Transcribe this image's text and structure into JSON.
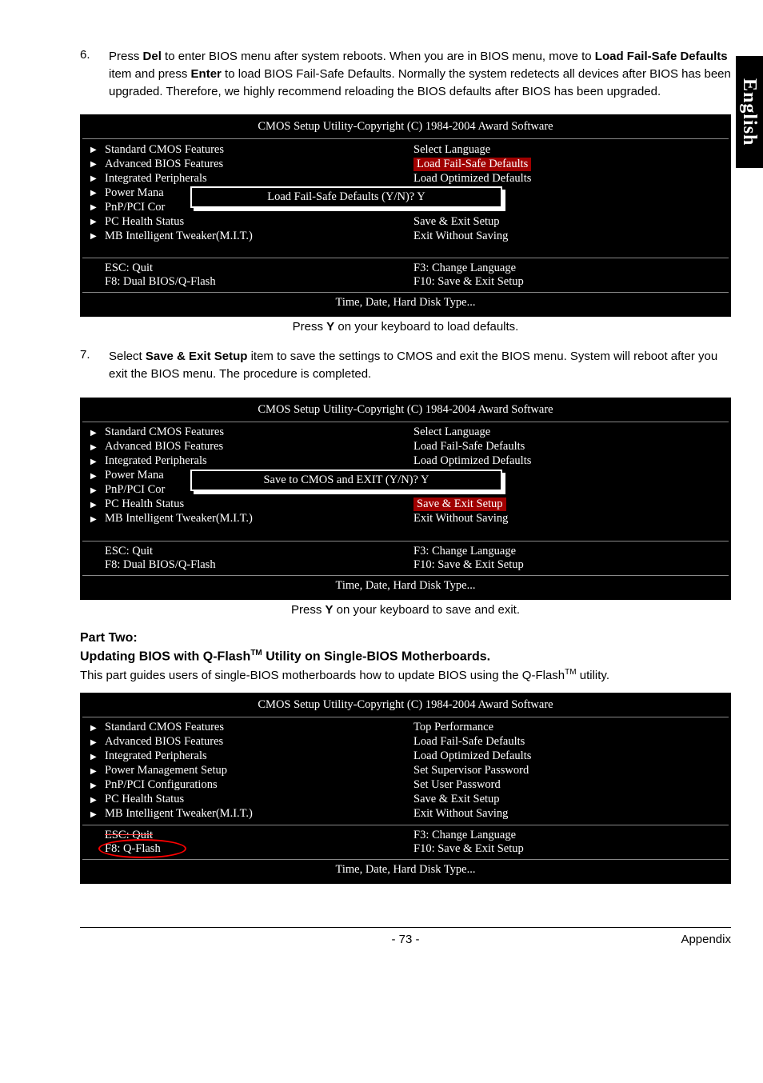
{
  "side_tab": "English",
  "step6": {
    "num": "6.",
    "text_a": "Press ",
    "key1": "Del",
    "text_b": " to enter BIOS menu after system reboots. When you are in BIOS menu, move to ",
    "bold2": "Load Fail-Safe Defaults",
    "text_c": " item and press ",
    "key2": "Enter",
    "text_d": " to load BIOS Fail-Safe Defaults. Normally the system redetects all devices after BIOS has been upgraded. Therefore, we highly recommend reloading the BIOS defaults after BIOS has been upgraded."
  },
  "bios1": {
    "title": "CMOS Setup Utility-Copyright (C) 1984-2004 Award Software",
    "left": [
      "Standard CMOS Features",
      "Advanced BIOS Features",
      "Integrated Peripherals",
      "Power Mana",
      "PnP/PCI Cor",
      "PC Health Status",
      "MB Intelligent Tweaker(M.I.T.)"
    ],
    "right": [
      "Select Language",
      "Load Fail-Safe Defaults",
      "Load Optimized Defaults",
      "",
      "",
      "Save & Exit Setup",
      "Exit Without Saving"
    ],
    "highlight_right_index": 1,
    "dialog": "Load Fail-Safe Defaults (Y/N)? Y",
    "help_l1": "ESC: Quit",
    "help_l2": "F8: Dual BIOS/Q-Flash",
    "help_r1": "F3: Change Language",
    "help_r2": "F10: Save & Exit Setup",
    "foot": "Time, Date, Hard Disk Type..."
  },
  "caption1_a": "Press ",
  "caption1_key": "Y",
  "caption1_b": " on your keyboard to load defaults.",
  "step7": {
    "num": "7.",
    "text_a": "Select ",
    "bold1": "Save & Exit Setup",
    "text_b": " item to save the settings to CMOS and exit the BIOS menu. System will reboot after you exit the BIOS menu. The procedure is completed."
  },
  "bios2": {
    "title": "CMOS Setup Utility-Copyright (C) 1984-2004 Award Software",
    "left": [
      "Standard CMOS Features",
      "Advanced BIOS Features",
      "Integrated Peripherals",
      "Power Mana",
      "PnP/PCI Cor",
      "PC Health Status",
      "MB Intelligent Tweaker(M.I.T.)"
    ],
    "right": [
      "Select Language",
      "Load Fail-Safe Defaults",
      "Load Optimized Defaults",
      "",
      "",
      "Save & Exit Setup",
      "Exit Without Saving"
    ],
    "highlight_right_index": 5,
    "dialog": "Save to CMOS and EXIT (Y/N)? Y",
    "help_l1": "ESC: Quit",
    "help_l2": "F8: Dual BIOS/Q-Flash",
    "help_r1": "F3: Change Language",
    "help_r2": "F10: Save & Exit Setup",
    "foot": "Time, Date, Hard Disk Type..."
  },
  "caption2_a": "Press ",
  "caption2_key": "Y",
  "caption2_b": " on your keyboard to save and exit.",
  "part_two": "Part Two:",
  "part_two_h_a": "Updating BIOS with Q-Flash",
  "part_two_tm": "TM",
  "part_two_h_b": " Utility on Single-BIOS Motherboards.",
  "part_two_p_a": "This part guides users of single-BIOS motherboards how to update BIOS using the Q-Flash",
  "part_two_p_b": " utility.",
  "bios3": {
    "title": "CMOS Setup Utility-Copyright (C) 1984-2004 Award Software",
    "left": [
      "Standard CMOS Features",
      "Advanced BIOS Features",
      "Integrated Peripherals",
      "Power Management Setup",
      "PnP/PCI Configurations",
      "PC Health Status",
      "MB Intelligent Tweaker(M.I.T.)"
    ],
    "right": [
      "Top Performance",
      "Load Fail-Safe Defaults",
      "Load Optimized Defaults",
      "Set Supervisor Password",
      "Set User Password",
      "Save & Exit Setup",
      "Exit Without Saving"
    ],
    "help_l1": "ESC: Quit",
    "help_l2": "F8: Q-Flash",
    "help_r1": "F3: Change Language",
    "help_r2": "F10: Save & Exit Setup",
    "foot": "Time, Date, Hard Disk Type..."
  },
  "footer": {
    "page": "- 73 -",
    "section": "Appendix"
  }
}
